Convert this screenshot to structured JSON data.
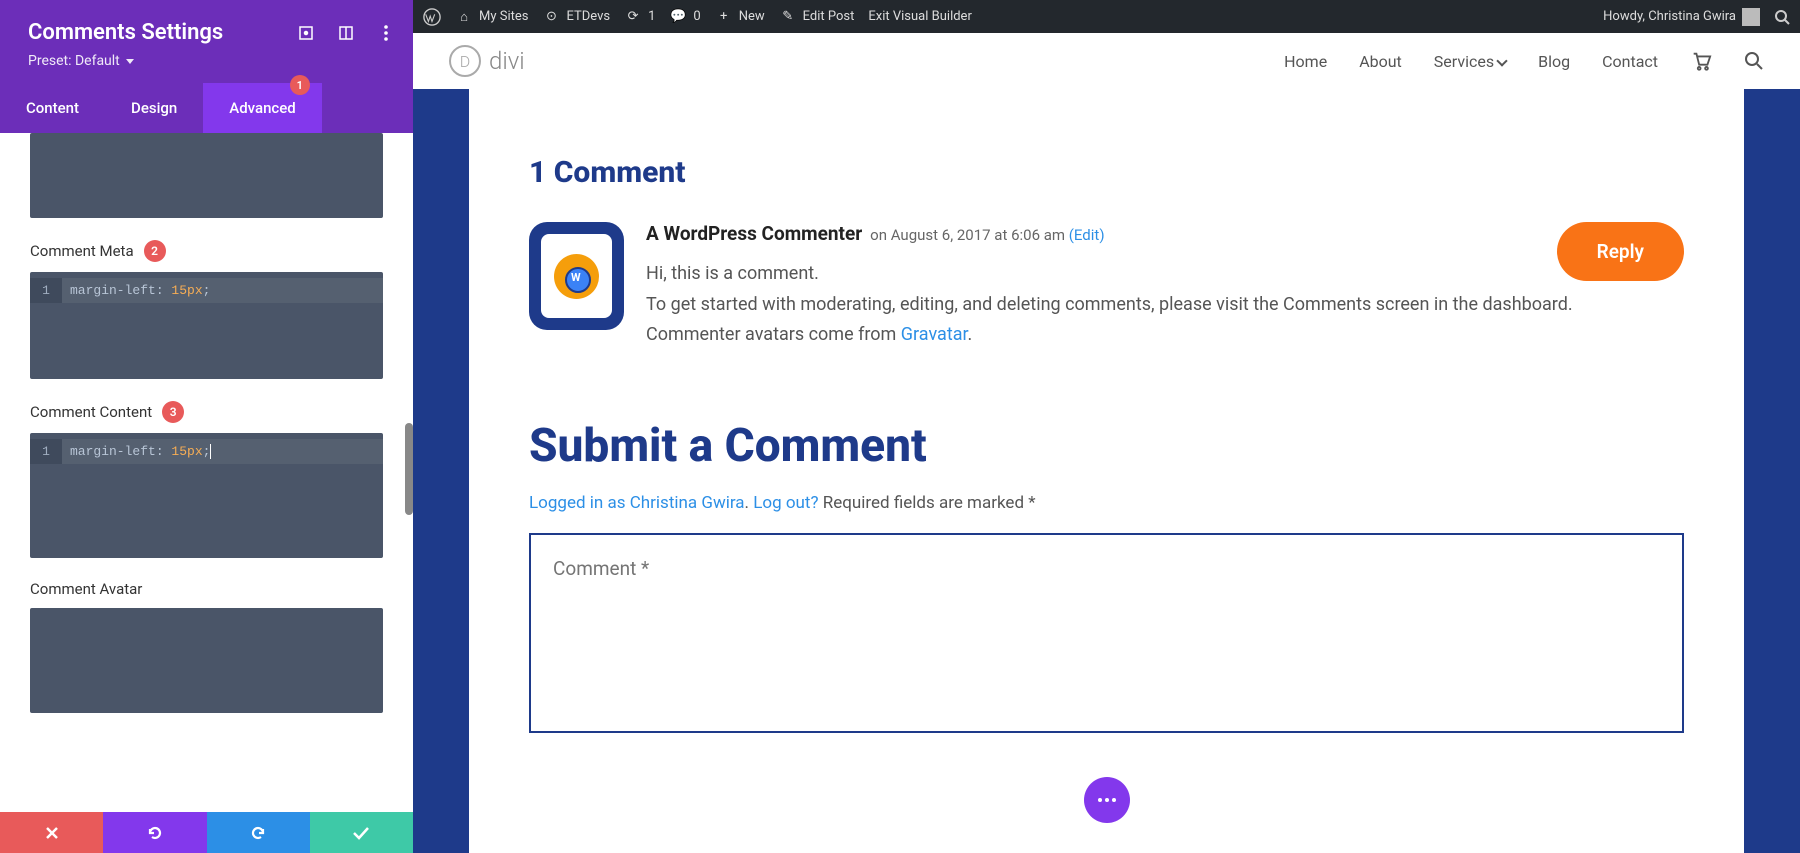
{
  "panel": {
    "title": "Comments Settings",
    "preset": "Preset: Default",
    "tabs": {
      "content": "Content",
      "design": "Design",
      "advanced": "Advanced",
      "badge": "1"
    },
    "fields": {
      "meta": {
        "label": "Comment Meta",
        "marker": "2",
        "line": "1",
        "prop": "margin-left:",
        "val": " 15px",
        "semi": ";"
      },
      "content": {
        "label": "Comment Content",
        "marker": "3",
        "line": "1",
        "prop": "margin-left:",
        "val": " 15px",
        "semi": ";"
      },
      "avatar": {
        "label": "Comment Avatar"
      }
    }
  },
  "wpbar": {
    "mysites": "My Sites",
    "etdevs": "ETDevs",
    "refresh": "1",
    "comments": "0",
    "new": "New",
    "edit": "Edit Post",
    "exit": "Exit Visual Builder",
    "howdy": "Howdy, Christina Gwira"
  },
  "nav": {
    "logo": "divi",
    "logoD": "D",
    "home": "Home",
    "about": "About",
    "services": "Services",
    "blog": "Blog",
    "contact": "Contact"
  },
  "page": {
    "commentsTitle": "1 Comment",
    "author": "A WordPress Commenter",
    "meta": "on August 6, 2017 at 6:06 am ",
    "edit": "(Edit)",
    "line1": "Hi, this is a comment.",
    "line2": "To get started with moderating, editing, and deleting comments, please visit the Comments screen in the dashboard.",
    "line3a": "Commenter avatars come from ",
    "gravatar": "Gravatar",
    "dot": ".",
    "reply": "Reply",
    "submitTitle": "Submit a Comment",
    "loggedIn": "Logged in as Christina Gwira",
    "logout": "Log out?",
    "required": " Required fields are marked *",
    "commentPlaceholder": "Comment *",
    "sepDot": ". "
  }
}
